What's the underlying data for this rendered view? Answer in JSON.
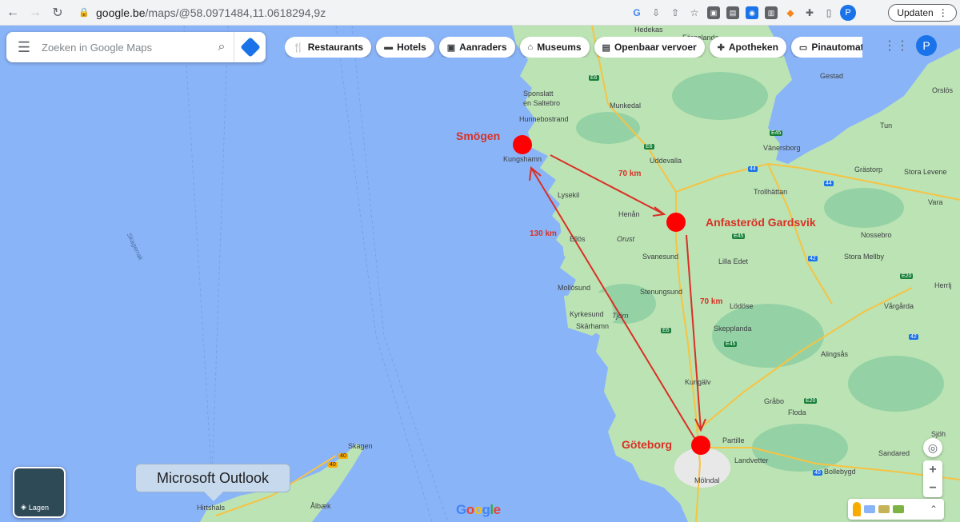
{
  "browser": {
    "url_host": "google.be",
    "url_path": "/maps/@58.0971484,11.0618294,9z",
    "profile_initial": "P",
    "update_label": "Updaten"
  },
  "search": {
    "placeholder": "Zoeken in Google Maps"
  },
  "chips": [
    {
      "icon": "utensils-icon",
      "label": "Restaurants"
    },
    {
      "icon": "bed-icon",
      "label": "Hotels"
    },
    {
      "icon": "camera-icon",
      "label": "Aanraders"
    },
    {
      "icon": "museum-icon",
      "label": "Museums"
    },
    {
      "icon": "bus-icon",
      "label": "Openbaar vervoer"
    },
    {
      "icon": "pharmacy-icon",
      "label": "Apotheken"
    },
    {
      "icon": "atm-icon",
      "label": "Pinautomate"
    }
  ],
  "account": {
    "initial": "P"
  },
  "layers": {
    "label": "Lagen"
  },
  "tooltip": {
    "text": "Microsoft Outlook"
  },
  "logo": {
    "text": "Google"
  },
  "annotations": {
    "smogen": "Smögen",
    "gardsvik": "Anfasteröd Gardsvik",
    "goteborg": "Göteborg",
    "dist_1": "70 km",
    "dist_2": "70 km",
    "dist_3": "130 km"
  },
  "places": {
    "hedekas": "Hedekas",
    "fargelanda": "Färgelanda",
    "gestad": "Gestad",
    "sponsatt": "Sponslatt",
    "saltebro": "en Saltebro",
    "hunnebostrand": "Hunnebostrand",
    "munkedal": "Munkedal",
    "kungshamn": "Kungshamn",
    "vanersborg": "Vänersborg",
    "uddevalla": "Uddevalla",
    "trollhattan": "Trollhättan",
    "grastorp": "Grästorp",
    "stora_levene": "Stora Levene",
    "vara": "Vara",
    "tun": "Tun",
    "orslos": "Orslös",
    "lysekil": "Lysekil",
    "henan": "Henån",
    "ellos": "Ellös",
    "orust": "Orust",
    "svanesund": "Svanesund",
    "lilla_edet": "Lilla Edet",
    "nossebro": "Nossebro",
    "stora_mellby": "Stora Mellby",
    "herrljunga": "Herrlj",
    "mollosund": "Mollösund",
    "stenungsund": "Stenungsund",
    "lodose": "Lödöse",
    "vargarda": "Vårgårda",
    "kyrkesund": "Kyrkesund",
    "tjorn": "Tjörn",
    "skarhamn": "Skärhamn",
    "skepplanda": "Skepplanda",
    "alingsas": "Alingsås",
    "kungalv": "Kungälv",
    "grabo": "Gråbo",
    "floda": "Floda",
    "partille": "Partille",
    "landvetter": "Landvetter",
    "sjoh": "Sjöh",
    "sandared": "Sandared",
    "bollebygd": "Bollebygd",
    "molndal": "Mölndal",
    "skagen": "Skagen",
    "albaek": "Ålbæk",
    "hirtshals": "Hirtshals",
    "skagerrak": "Skagerrak"
  },
  "colors": {
    "water": "#8ab4f8",
    "land": "#bce3b4",
    "land_dark": "#94d2a5",
    "annotation_red": "#d93025",
    "accent_blue": "#1a73e8"
  }
}
